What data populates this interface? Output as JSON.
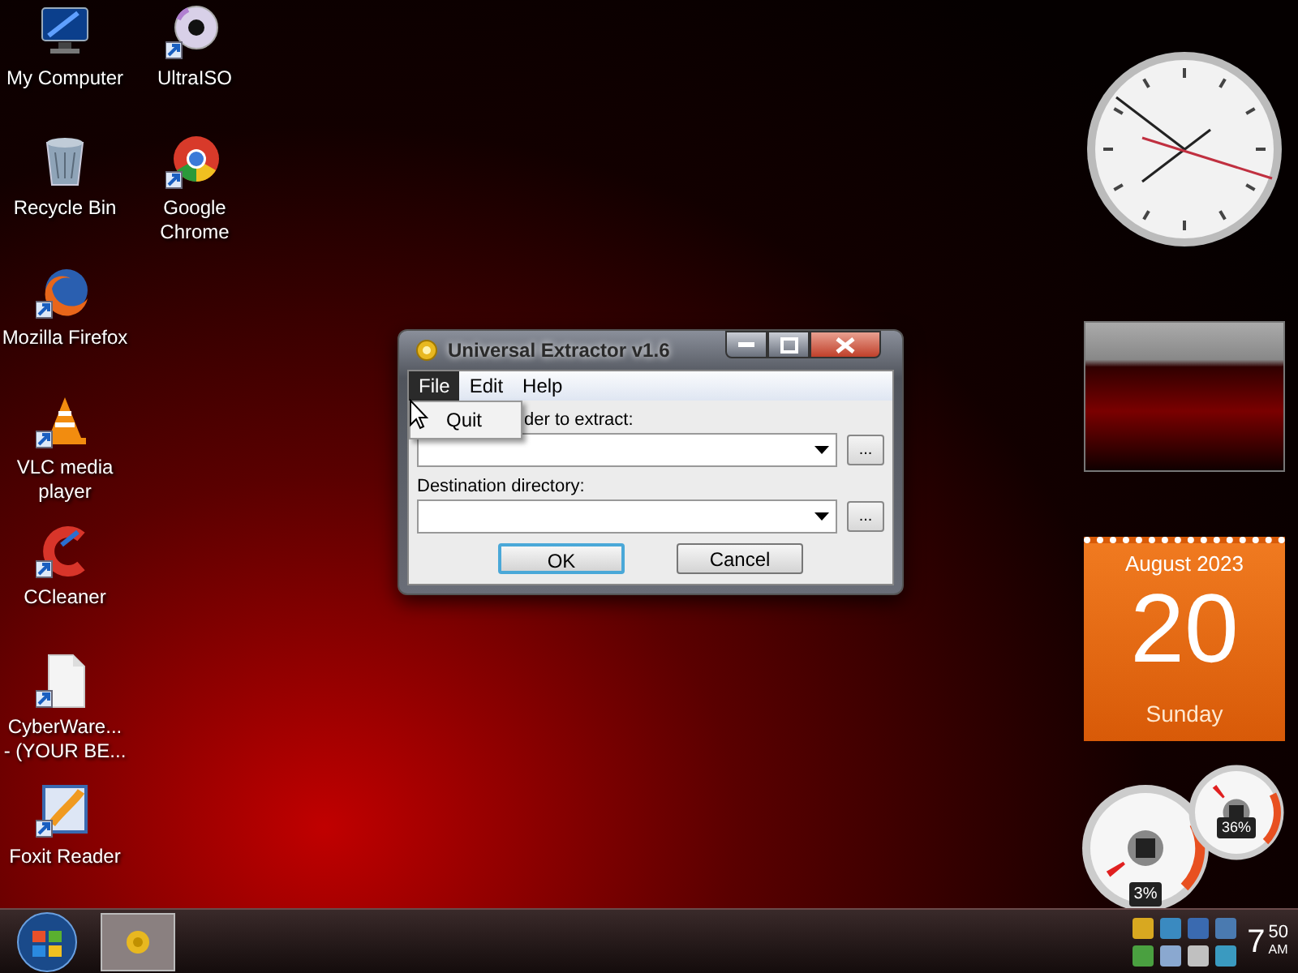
{
  "icon_columns": [
    {
      "icons": [
        {
          "label": "My Computer",
          "kind": "computer",
          "shortcut": false
        },
        {
          "label": "Recycle Bin",
          "kind": "bin",
          "shortcut": false
        },
        {
          "label": "Mozilla Firefox",
          "kind": "firefox",
          "shortcut": true
        },
        {
          "label": "VLC media\nplayer",
          "kind": "cone",
          "shortcut": true
        },
        {
          "label": "CCleaner",
          "kind": "cleaner",
          "shortcut": true
        },
        {
          "label": "CyberWare...\n- (YOUR BE...",
          "kind": "document",
          "shortcut": true
        },
        {
          "label": "Foxit Reader",
          "kind": "pdf",
          "shortcut": true
        }
      ]
    },
    {
      "icons": [
        {
          "label": "UltraISO",
          "kind": "disc",
          "shortcut": true
        },
        {
          "label": "Google\nChrome",
          "kind": "chrome",
          "shortcut": true
        }
      ]
    }
  ],
  "window": {
    "title": "Universal Extractor v1.6",
    "menu": [
      {
        "label": "File",
        "selected": true
      },
      {
        "label": "Edit",
        "selected": false
      },
      {
        "label": "Help",
        "selected": false
      }
    ],
    "open_menu": {
      "items": [
        "Quit"
      ]
    },
    "fields": [
      {
        "label": "der to extract:"
      },
      {
        "label": "Destination directory:"
      }
    ],
    "browse_label": "...",
    "buttons": [
      {
        "label": "OK",
        "default": true
      },
      {
        "label": "Cancel",
        "default": false
      }
    ]
  },
  "calendar": {
    "month": "August 2023",
    "day": "20",
    "weekday": "Sunday"
  },
  "gauges": [
    {
      "reading": "3%"
    },
    {
      "reading": "36%"
    }
  ],
  "taskbar": {
    "tasks": [
      {
        "selected": true
      }
    ],
    "clock": {
      "hour": "7",
      "minute": "50",
      "ampm": "AM"
    }
  }
}
